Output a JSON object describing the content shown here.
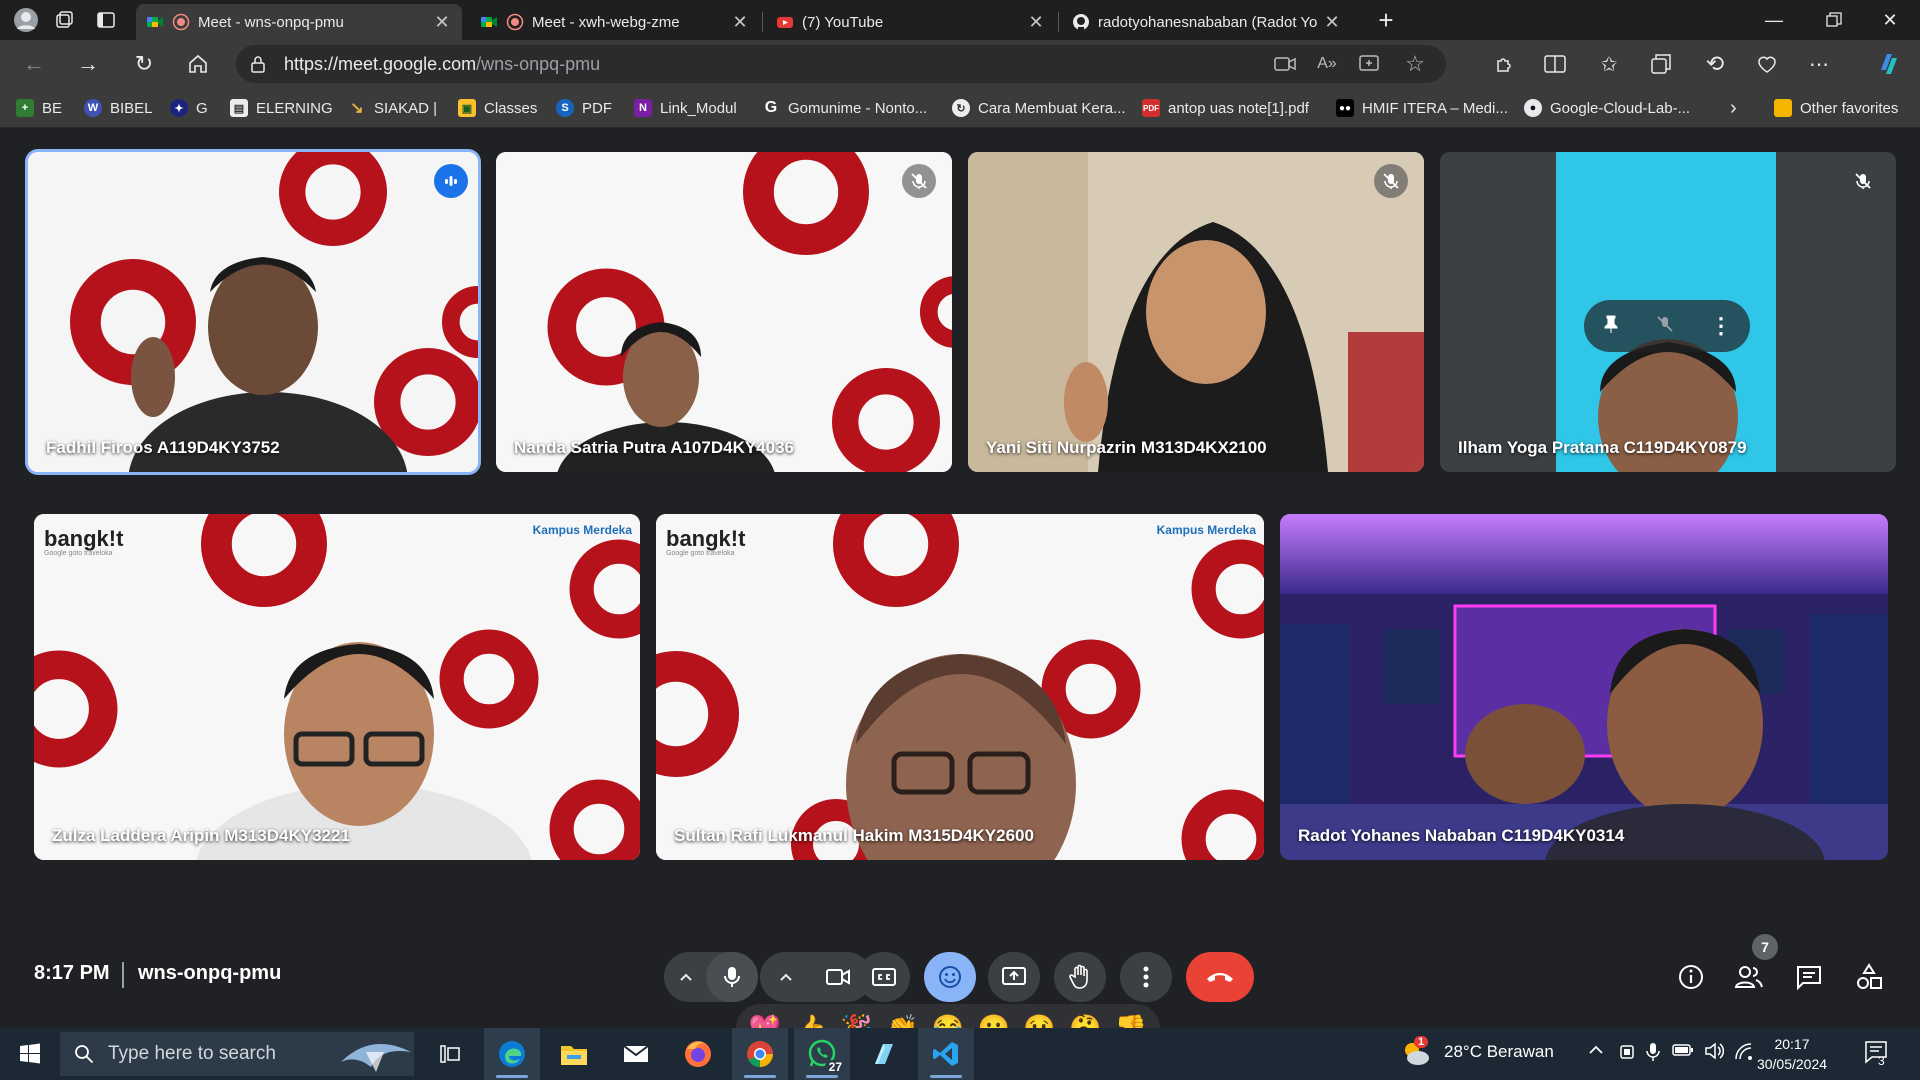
{
  "browser": {
    "tabs": [
      {
        "title": "Meet - wns-onpq-pmu",
        "active": true
      },
      {
        "title": "Meet - xwh-webg-zme",
        "active": false
      },
      {
        "title": "(7) YouTube",
        "active": false
      },
      {
        "title": "radotyohanesnababan (Radot Yo",
        "active": false
      }
    ],
    "url_host": "https://meet.google.com",
    "url_path": "/wns-onpq-pmu",
    "bookmarks": [
      "BE",
      "BIBEL",
      "G",
      "ELERNING",
      "SIAKAD |",
      "Classes",
      "PDF",
      "Link_Modul",
      "Gomunime - Nonto...",
      "Cara Membuat Kera...",
      "antop uas note[1].pdf",
      "HMIF ITERA – Medi...",
      "Google-Cloud-Lab-..."
    ],
    "other_favorites": "Other favorites"
  },
  "participants": [
    {
      "name": "Fadhil Firoos A119D4KY3752"
    },
    {
      "name": "Nanda Satria Putra A107D4KY4036"
    },
    {
      "name": "Yani Siti Nurpazrin M313D4KX2100"
    },
    {
      "name": "Ilham Yoga Pratama C119D4KY0879"
    },
    {
      "name": "Zulza Laddera Aripin M313D4KY3221"
    },
    {
      "name": "Sultan Rafi Lukmanul Hakim M315D4KY2600"
    },
    {
      "name": "Radot Yohanes Nababan C119D4KY0314"
    }
  ],
  "branding": {
    "bangkit": "bangk!t",
    "bangkit_sub": "Google  goto  traveloka",
    "kampus": "Kampus Merdeka"
  },
  "reactions": [
    "💖",
    "👍",
    "🎉",
    "👏",
    "😂",
    "😮",
    "😢",
    "🤔",
    "👎"
  ],
  "meeting": {
    "time": "8:17 PM",
    "code": "wns-onpq-pmu",
    "people_count": "7"
  },
  "taskbar": {
    "search_placeholder": "Type here to search",
    "whatsapp_badge": "27",
    "weather": "28°C  Berawan",
    "weather_badge": "1",
    "time": "20:17",
    "date": "30/05/2024",
    "notifications": "3"
  },
  "colors": {
    "accent": "#8ab4f8",
    "end_call": "#ea4335",
    "active_blue": "#8ab4f8",
    "bg": "#202124",
    "bangkit_red": "#b5121b"
  }
}
